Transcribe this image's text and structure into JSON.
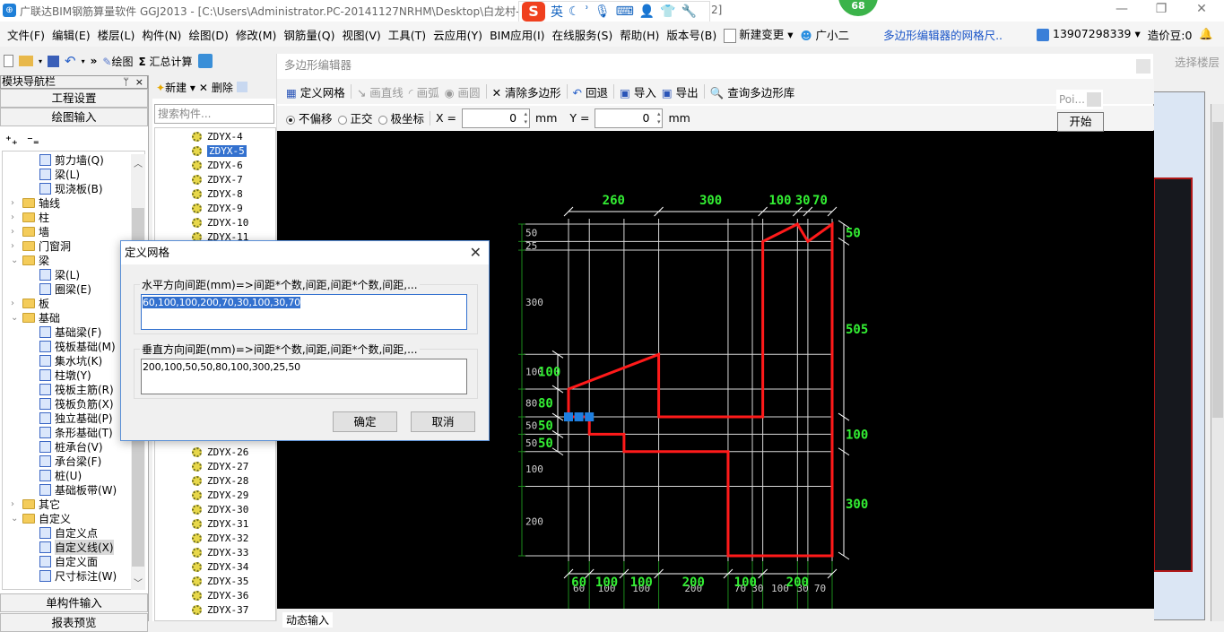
{
  "window": {
    "title": "广联达BIM钢筋算量软件 GGJ2013 - [C:\\Users\\Administrator.PC-20141127NRHM\\Desktop\\白龙村-",
    "title_tail": "2]",
    "badge": "68",
    "controls": {
      "minimize": "—",
      "restore": "❐",
      "close": "✕"
    }
  },
  "ime": {
    "logo": "S",
    "mode": "英",
    "icons": [
      "moon-icon",
      "punct-icon",
      "mic-icon",
      "keyboard-icon",
      "user-icon",
      "shirt-icon",
      "wrench-icon"
    ]
  },
  "menubar": {
    "items": [
      "文件(F)",
      "编辑(E)",
      "楼层(L)",
      "构件(N)",
      "绘图(D)",
      "修改(M)",
      "钢筋量(Q)",
      "视图(V)",
      "工具(T)",
      "云应用(Y)",
      "BIM应用(I)",
      "在线服务(S)",
      "帮助(H)",
      "版本号(B)"
    ],
    "new_change": "新建变更",
    "assistant": "广小二",
    "link": "多边形编辑器的网格尺..",
    "account": "13907298339",
    "beans": "造价豆:0",
    "overflow": "»"
  },
  "toolbar": {
    "draw": "绘图",
    "sum": "汇总计算",
    "sum_icon": "Σ",
    "more": "»"
  },
  "nav": {
    "title": "模块导航栏",
    "pin": "ᛘ",
    "close": "×",
    "project_settings": "工程设置",
    "drawing_input": "绘图输入",
    "single_input": "单构件输入",
    "report": "报表预览",
    "tree": [
      {
        "label": "剪力墙(Q)",
        "level": 2
      },
      {
        "label": "梁(L)",
        "level": 2
      },
      {
        "label": "现浇板(B)",
        "level": 2
      },
      {
        "label": "轴线",
        "level": 1,
        "folder": true,
        "expanded": false
      },
      {
        "label": "柱",
        "level": 1,
        "folder": true,
        "expanded": false
      },
      {
        "label": "墙",
        "level": 1,
        "folder": true,
        "expanded": false
      },
      {
        "label": "门窗洞",
        "level": 1,
        "folder": true,
        "expanded": false
      },
      {
        "label": "梁",
        "level": 1,
        "folder": true,
        "expanded": true
      },
      {
        "label": "梁(L)",
        "level": 2
      },
      {
        "label": "圈梁(E)",
        "level": 2
      },
      {
        "label": "板",
        "level": 1,
        "folder": true,
        "expanded": false
      },
      {
        "label": "基础",
        "level": 1,
        "folder": true,
        "expanded": true
      },
      {
        "label": "基础梁(F)",
        "level": 2
      },
      {
        "label": "筏板基础(M)",
        "level": 2
      },
      {
        "label": "集水坑(K)",
        "level": 2
      },
      {
        "label": "柱墩(Y)",
        "level": 2
      },
      {
        "label": "筏板主筋(R)",
        "level": 2
      },
      {
        "label": "筏板负筋(X)",
        "level": 2
      },
      {
        "label": "独立基础(P)",
        "level": 2
      },
      {
        "label": "条形基础(T)",
        "level": 2
      },
      {
        "label": "桩承台(V)",
        "level": 2
      },
      {
        "label": "承台梁(F)",
        "level": 2
      },
      {
        "label": "桩(U)",
        "level": 2
      },
      {
        "label": "基础板带(W)",
        "level": 2
      },
      {
        "label": "其它",
        "level": 1,
        "folder": true,
        "expanded": false
      },
      {
        "label": "自定义",
        "level": 1,
        "folder": true,
        "expanded": true
      },
      {
        "label": "自定义点",
        "level": 2
      },
      {
        "label": "自定义线(X)",
        "level": 2,
        "selected": true
      },
      {
        "label": "自定义面",
        "level": 2
      },
      {
        "label": "尺寸标注(W)",
        "level": 2
      }
    ]
  },
  "components": {
    "new": "新建",
    "delete": "删除",
    "search_placeholder": "搜索构件...",
    "top_items": [
      "ZDYX-4",
      "ZDYX-5",
      "ZDYX-6",
      "ZDYX-7",
      "ZDYX-8",
      "ZDYX-9",
      "ZDYX-10",
      "ZDYX-11"
    ],
    "selected": "ZDYX-5",
    "bottom_items": [
      "ZDYX-26",
      "ZDYX-27",
      "ZDYX-28",
      "ZDYX-29",
      "ZDYX-30",
      "ZDYX-31",
      "ZDYX-32",
      "ZDYX-33",
      "ZDYX-34",
      "ZDYX-35",
      "ZDYX-36",
      "ZDYX-37"
    ]
  },
  "editor": {
    "title": "多边形编辑器",
    "toolbar": {
      "define_grid": "定义网格",
      "draw_line": "画直线",
      "draw_arc": "画弧",
      "draw_circle": "画圆",
      "clear_polygon": "清除多边形",
      "undo": "回退",
      "import": "导入",
      "export": "导出",
      "query_library": "查询多边形库"
    },
    "snap": {
      "options": [
        "不偏移",
        "正交",
        "极坐标"
      ],
      "selected": "不偏移"
    },
    "x_label": "X =",
    "x_value": "0",
    "y_label": "Y =",
    "y_value": "0",
    "unit": "mm",
    "status_tab": "动态输入",
    "select_floor": "选择楼层"
  },
  "popup": {
    "poi": "Poi...",
    "start": "开始"
  },
  "drawing": {
    "h_spacings": [
      60,
      100,
      100,
      200,
      70,
      30,
      100,
      30,
      70
    ],
    "v_spacings_bottom_up": [
      200,
      100,
      50,
      50,
      80,
      100,
      300,
      25,
      50
    ],
    "top_dims": [
      "260",
      "300",
      "100",
      "30",
      "70"
    ],
    "right_dims": [
      "50",
      "505",
      "100",
      "300"
    ],
    "left_dims_green": [
      "100",
      "80",
      "50",
      "50"
    ],
    "bottom_dims_green": [
      "60",
      "100",
      "100",
      "200",
      "100",
      "200"
    ],
    "polygon_color": "#ff1a1a",
    "dim_color": "#33ee33"
  },
  "dialog": {
    "title": "定义网格",
    "h_label": "水平方向间距(mm)=>间距*个数,间距,间距*个数,间距,...",
    "h_value": "60,100,100,200,70,30,100,30,70",
    "v_label": "垂直方向间距(mm)=>间距*个数,间距,间距*个数,间距,...",
    "v_value": "200,100,50,50,80,100,300,25,50",
    "ok": "确定",
    "cancel": "取消"
  }
}
